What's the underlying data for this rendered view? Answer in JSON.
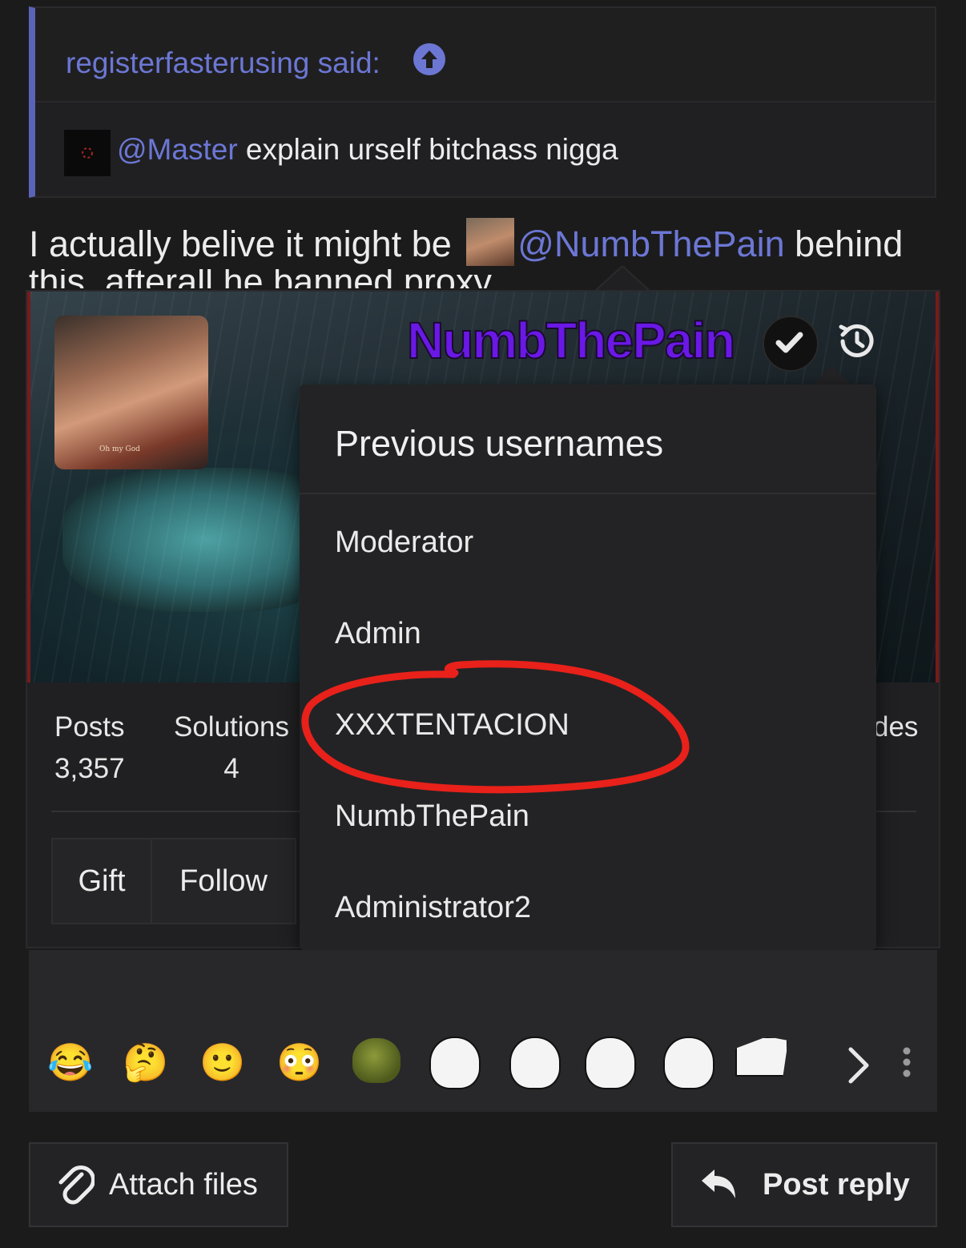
{
  "quote": {
    "author_said": "registerfasterusing said:",
    "mention": "@Master",
    "text": " explain urself bitchass nigga"
  },
  "post": {
    "prefix": "I actually belive it might be",
    "mention": "@NumbThePain",
    "suffix": " behind",
    "cutoff_line": "this, afterall he banned proxy"
  },
  "profile_card": {
    "username": "NumbThePain",
    "avatar_caption": "Oh my God",
    "stats": [
      {
        "label": "Posts",
        "value": "3,357"
      },
      {
        "label": "Solutions",
        "value": "4"
      },
      {
        "label": "des",
        "value": ""
      }
    ],
    "buttons": {
      "gift": "Gift",
      "follow": "Follow"
    }
  },
  "previous_usernames": {
    "title": "Previous usernames",
    "items": [
      "Moderator",
      "Admin",
      "XXXTENTACION",
      "NumbThePain",
      "Administrator2"
    ],
    "highlighted": "XXXTENTACION",
    "highlight_color": "#e8211a"
  },
  "editor": {
    "emojis": [
      "😂",
      "🤔",
      "🙂",
      "😳"
    ],
    "more_icon": "chevron-right-icon",
    "menu_icon": "kebab-menu-icon"
  },
  "actions": {
    "attach_files": "Attach files",
    "post_reply": "Post reply"
  },
  "colors": {
    "background": "#1b1b1c",
    "link": "#6c77d4",
    "username": "#6a18e6"
  }
}
